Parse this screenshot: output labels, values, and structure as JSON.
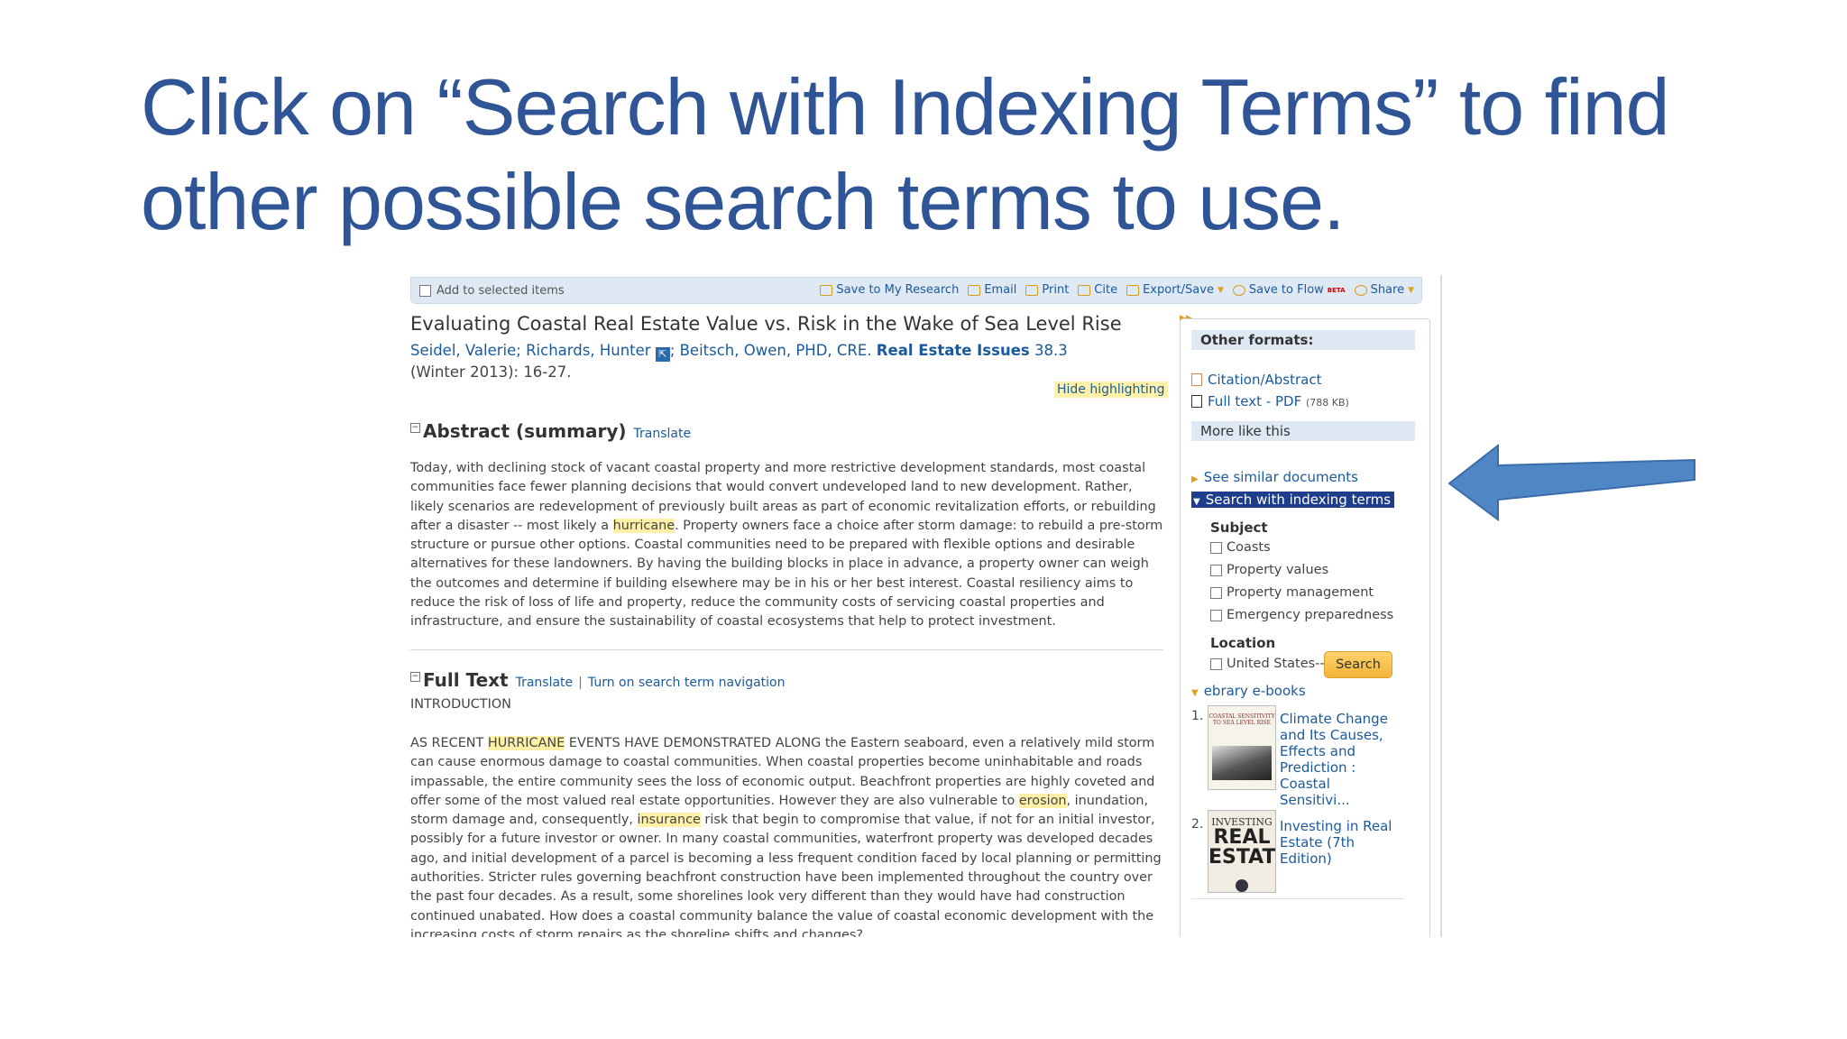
{
  "slide": {
    "title_line1": "Click on “Search with Indexing Terms” to find",
    "title_line2": "other possible search terms to use."
  },
  "toolbar": {
    "add_label": "Add to selected items",
    "actions": [
      "Save to My Research",
      "Email",
      "Print",
      "Cite",
      "Export/Save",
      "Save to Flow",
      "Share"
    ],
    "beta": "BETA"
  },
  "article": {
    "title": "Evaluating Coastal Real Estate Value vs. Risk in the Wake of Sea Level Rise",
    "authors_a": "Seidel, Valerie; Richards, Hunter",
    "authors_b": "; Beitsch, Owen, PHD, CRE.",
    "journal": "Real Estate Issues",
    "volume": "38.3",
    "date_pages": "(Winter 2013): 16-27.",
    "hide_highlighting": "Hide highlighting"
  },
  "abstract": {
    "heading": "Abstract (summary)",
    "translate": "Translate",
    "toggle": "−",
    "text_1": "Today, with declining stock of vacant coastal property and more restrictive development standards, most coastal communities face fewer planning decisions that would convert undeveloped land to new development. Rather, likely scenarios are redevelopment of previously built areas as part of economic revitalization efforts, or rebuilding after a disaster -- most likely a ",
    "hl_1": "hurricane",
    "text_2": ". Property owners face a choice after storm damage: to rebuild a pre-storm structure or pursue other options. Coastal communities need to be prepared with flexible options and desirable alternatives for these landowners. By having the building blocks in place in advance, a property owner can weigh the outcomes and determine if building elsewhere may be in his or her best interest. Coastal resiliency aims to reduce the risk of loss of life and property, reduce the community costs of servicing coastal properties and infrastructure, and ensure the sustainability of coastal ecosystems that help to protect investment."
  },
  "fulltext": {
    "heading": "Full Text",
    "translate": "Translate",
    "sep": "|",
    "nav": "Turn on search term navigation",
    "intro": "INTRODUCTION",
    "t1": "AS RECENT ",
    "h1": "HURRICANE",
    "t2": " EVENTS HAVE DEMONSTRATED ALONG the Eastern seaboard, even a relatively mild storm can cause enormous damage to coastal communities. When coastal properties become uninhabitable and roads impassable, the entire community sees the loss of economic output. Beachfront properties are highly coveted and offer some of the most valued real estate opportunities. However they are also vulnerable to ",
    "h2": "erosion",
    "t3": ", inundation, storm damage and, consequently, ",
    "h3": "insurance",
    "t4": " risk that begin to compromise that value, if not for an initial investor, possibly for a future investor or owner. In many coastal communities, waterfront property was developed decades ago, and initial development of a parcel is becoming a less frequent condition faced by local planning or permitting authorities. Stricter rules governing beachfront construction have been implemented throughout the country over the past four decades. As a result, some shorelines look very different than they would have had construction continued unabated. How does a coastal community balance the value of coastal economic development with the increasing costs of storm repairs as the shoreline shifts and changes?"
  },
  "sidebar": {
    "other_formats": "Other formats:",
    "citation": "Citation/Abstract",
    "fulltext_pdf": "Full text - PDF",
    "pdf_size": "(788 KB)",
    "more_like": "More like this",
    "similar": "See similar documents",
    "indexing": "Search with indexing terms",
    "subject_label": "Subject",
    "subjects": [
      "Coasts",
      "Property values",
      "Property management",
      "Emergency preparedness"
    ],
    "location_label": "Location",
    "locations": [
      "United States--US"
    ],
    "search_button": "Search",
    "ebrary": "ebrary e-books",
    "books": [
      {
        "num": "1.",
        "title": "Climate Change and Its Causes, Effects and Prediction : Coastal Sensitivi...",
        "cover_text": "COASTAL SENSITIVITY TO SEA LEVEL RISE"
      },
      {
        "num": "2.",
        "title": "Investing in Real Estate (7th Edition)",
        "cover_top": "INVESTING",
        "cover_big1": "REAL",
        "cover_big2": "ESTATE"
      }
    ]
  },
  "colors": {
    "title": "#2f5597",
    "link": "#1a5a9c",
    "highlight": "#fff2a8",
    "arrow": "#4f86c6"
  }
}
